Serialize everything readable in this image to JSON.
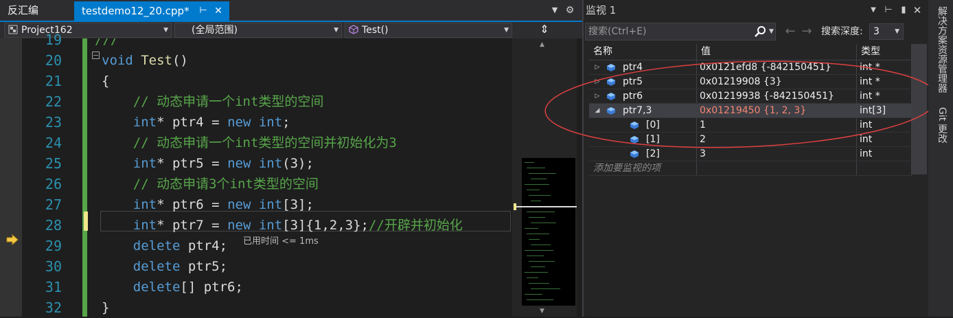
{
  "tabs": {
    "disasm": "反汇编",
    "active": "testdemo12_20.cpp*",
    "pin_icon": "pin-icon",
    "close_icon": "close-icon"
  },
  "navbar": {
    "project": "Project162",
    "scope": "(全局范围)",
    "function": "Test()"
  },
  "editor": {
    "line_numbers": [
      "19",
      "20",
      "21",
      "22",
      "23",
      "24",
      "25",
      "26",
      "27",
      "28",
      "29",
      "30",
      "31",
      "32"
    ],
    "perf_tip": "已用时间 <= 1ms",
    "lines": [
      [
        {
          "c": "cm",
          "t": "///"
        }
      ],
      [
        {
          "c": "kw",
          "t": "void "
        },
        {
          "c": "fn",
          "t": "Test"
        },
        {
          "c": "pn",
          "t": "()"
        }
      ],
      [
        {
          "c": "pn",
          "t": "{"
        }
      ],
      [
        {
          "c": "cm",
          "t": "    // 动态申请一个int类型的空间"
        }
      ],
      [
        {
          "c": "kw",
          "t": "    int"
        },
        {
          "c": "pn",
          "t": "* "
        },
        {
          "c": "id",
          "t": "ptr4"
        },
        {
          "c": "pn",
          "t": " = "
        },
        {
          "c": "kw",
          "t": "new int"
        },
        {
          "c": "pn",
          "t": ";"
        }
      ],
      [
        {
          "c": "cm",
          "t": "    // 动态申请一个int类型的空间并初始化为3"
        }
      ],
      [
        {
          "c": "kw",
          "t": "    int"
        },
        {
          "c": "pn",
          "t": "* "
        },
        {
          "c": "id",
          "t": "ptr5"
        },
        {
          "c": "pn",
          "t": " = "
        },
        {
          "c": "kw",
          "t": "new int"
        },
        {
          "c": "pn",
          "t": "(3);"
        }
      ],
      [
        {
          "c": "cm",
          "t": "    // 动态申请3个int类型的空间"
        }
      ],
      [
        {
          "c": "kw",
          "t": "    int"
        },
        {
          "c": "pn",
          "t": "* "
        },
        {
          "c": "id",
          "t": "ptr6"
        },
        {
          "c": "pn",
          "t": " = "
        },
        {
          "c": "kw",
          "t": "new int"
        },
        {
          "c": "pn",
          "t": "[3];"
        }
      ],
      [
        {
          "c": "kw",
          "t": "    int"
        },
        {
          "c": "pn",
          "t": "* "
        },
        {
          "c": "id",
          "t": "ptr7"
        },
        {
          "c": "pn",
          "t": " = "
        },
        {
          "c": "kw",
          "t": "new int"
        },
        {
          "c": "pn",
          "t": "[3]{1,2,3};"
        },
        {
          "c": "cm",
          "t": "//开辟并初始化"
        }
      ],
      [
        {
          "c": "kw",
          "t": "    delete "
        },
        {
          "c": "id",
          "t": "ptr4"
        },
        {
          "c": "pn",
          "t": ";"
        }
      ],
      [
        {
          "c": "kw",
          "t": "    delete "
        },
        {
          "c": "id",
          "t": "ptr5"
        },
        {
          "c": "pn",
          "t": ";"
        }
      ],
      [
        {
          "c": "kw",
          "t": "    delete"
        },
        {
          "c": "pn",
          "t": "[] "
        },
        {
          "c": "id",
          "t": "ptr6"
        },
        {
          "c": "pn",
          "t": ";"
        }
      ],
      [
        {
          "c": "pn",
          "t": "}"
        }
      ]
    ]
  },
  "watch": {
    "title": "监视 1",
    "search_placeholder": "搜索(Ctrl+E)",
    "depth_label": "搜索深度:",
    "depth_value": "3",
    "headers": {
      "name": "名称",
      "value": "值",
      "type": "类型"
    },
    "rows": [
      {
        "name": "ptr4",
        "value": "0x0121efd8 {-842150451}",
        "type": "int *",
        "expand": "collapsed",
        "level": 0,
        "changed": false,
        "selected": false
      },
      {
        "name": "ptr5",
        "value": "0x01219908 {3}",
        "type": "int *",
        "expand": "collapsed",
        "level": 0,
        "changed": false,
        "selected": false
      },
      {
        "name": "ptr6",
        "value": "0x01219938 {-842150451}",
        "type": "int *",
        "expand": "collapsed",
        "level": 0,
        "changed": false,
        "selected": false
      },
      {
        "name": "ptr7,3",
        "value": "0x01219450 {1, 2, 3}",
        "type": "int[3]",
        "expand": "expanded",
        "level": 0,
        "changed": true,
        "selected": true
      },
      {
        "name": "[0]",
        "value": "1",
        "type": "int",
        "expand": "none",
        "level": 1,
        "changed": false,
        "selected": false
      },
      {
        "name": "[1]",
        "value": "2",
        "type": "int",
        "expand": "none",
        "level": 1,
        "changed": false,
        "selected": false
      },
      {
        "name": "[2]",
        "value": "3",
        "type": "int",
        "expand": "none",
        "level": 1,
        "changed": false,
        "selected": false
      }
    ],
    "add_placeholder": "添加要监视的项"
  },
  "rail": {
    "solution_explorer": "解决方案资源管理器",
    "git_changes": "Git 更改"
  },
  "colors": {
    "accent": "#007acc",
    "keyword": "#569cd6",
    "comment": "#57a64a",
    "function": "#dcdcaa",
    "line_number": "#2b91af",
    "changed_value": "#f48771",
    "annotation_ellipse": "#e04040"
  }
}
